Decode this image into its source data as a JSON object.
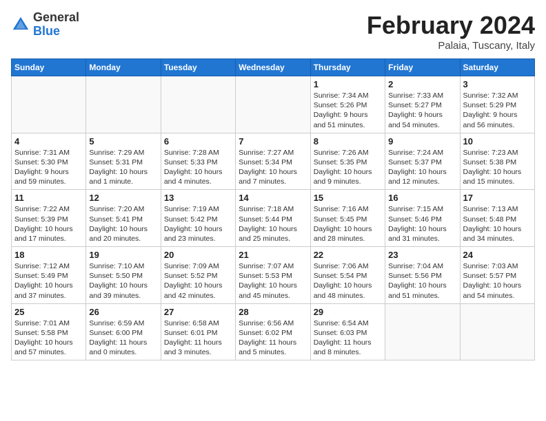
{
  "header": {
    "logo_general": "General",
    "logo_blue": "Blue",
    "month_title": "February 2024",
    "location": "Palaia, Tuscany, Italy"
  },
  "days_of_week": [
    "Sunday",
    "Monday",
    "Tuesday",
    "Wednesday",
    "Thursday",
    "Friday",
    "Saturday"
  ],
  "weeks": [
    [
      {
        "day": "",
        "info": ""
      },
      {
        "day": "",
        "info": ""
      },
      {
        "day": "",
        "info": ""
      },
      {
        "day": "",
        "info": ""
      },
      {
        "day": "1",
        "info": "Sunrise: 7:34 AM\nSunset: 5:26 PM\nDaylight: 9 hours\nand 51 minutes."
      },
      {
        "day": "2",
        "info": "Sunrise: 7:33 AM\nSunset: 5:27 PM\nDaylight: 9 hours\nand 54 minutes."
      },
      {
        "day": "3",
        "info": "Sunrise: 7:32 AM\nSunset: 5:29 PM\nDaylight: 9 hours\nand 56 minutes."
      }
    ],
    [
      {
        "day": "4",
        "info": "Sunrise: 7:31 AM\nSunset: 5:30 PM\nDaylight: 9 hours\nand 59 minutes."
      },
      {
        "day": "5",
        "info": "Sunrise: 7:29 AM\nSunset: 5:31 PM\nDaylight: 10 hours\nand 1 minute."
      },
      {
        "day": "6",
        "info": "Sunrise: 7:28 AM\nSunset: 5:33 PM\nDaylight: 10 hours\nand 4 minutes."
      },
      {
        "day": "7",
        "info": "Sunrise: 7:27 AM\nSunset: 5:34 PM\nDaylight: 10 hours\nand 7 minutes."
      },
      {
        "day": "8",
        "info": "Sunrise: 7:26 AM\nSunset: 5:35 PM\nDaylight: 10 hours\nand 9 minutes."
      },
      {
        "day": "9",
        "info": "Sunrise: 7:24 AM\nSunset: 5:37 PM\nDaylight: 10 hours\nand 12 minutes."
      },
      {
        "day": "10",
        "info": "Sunrise: 7:23 AM\nSunset: 5:38 PM\nDaylight: 10 hours\nand 15 minutes."
      }
    ],
    [
      {
        "day": "11",
        "info": "Sunrise: 7:22 AM\nSunset: 5:39 PM\nDaylight: 10 hours\nand 17 minutes."
      },
      {
        "day": "12",
        "info": "Sunrise: 7:20 AM\nSunset: 5:41 PM\nDaylight: 10 hours\nand 20 minutes."
      },
      {
        "day": "13",
        "info": "Sunrise: 7:19 AM\nSunset: 5:42 PM\nDaylight: 10 hours\nand 23 minutes."
      },
      {
        "day": "14",
        "info": "Sunrise: 7:18 AM\nSunset: 5:44 PM\nDaylight: 10 hours\nand 25 minutes."
      },
      {
        "day": "15",
        "info": "Sunrise: 7:16 AM\nSunset: 5:45 PM\nDaylight: 10 hours\nand 28 minutes."
      },
      {
        "day": "16",
        "info": "Sunrise: 7:15 AM\nSunset: 5:46 PM\nDaylight: 10 hours\nand 31 minutes."
      },
      {
        "day": "17",
        "info": "Sunrise: 7:13 AM\nSunset: 5:48 PM\nDaylight: 10 hours\nand 34 minutes."
      }
    ],
    [
      {
        "day": "18",
        "info": "Sunrise: 7:12 AM\nSunset: 5:49 PM\nDaylight: 10 hours\nand 37 minutes."
      },
      {
        "day": "19",
        "info": "Sunrise: 7:10 AM\nSunset: 5:50 PM\nDaylight: 10 hours\nand 39 minutes."
      },
      {
        "day": "20",
        "info": "Sunrise: 7:09 AM\nSunset: 5:52 PM\nDaylight: 10 hours\nand 42 minutes."
      },
      {
        "day": "21",
        "info": "Sunrise: 7:07 AM\nSunset: 5:53 PM\nDaylight: 10 hours\nand 45 minutes."
      },
      {
        "day": "22",
        "info": "Sunrise: 7:06 AM\nSunset: 5:54 PM\nDaylight: 10 hours\nand 48 minutes."
      },
      {
        "day": "23",
        "info": "Sunrise: 7:04 AM\nSunset: 5:56 PM\nDaylight: 10 hours\nand 51 minutes."
      },
      {
        "day": "24",
        "info": "Sunrise: 7:03 AM\nSunset: 5:57 PM\nDaylight: 10 hours\nand 54 minutes."
      }
    ],
    [
      {
        "day": "25",
        "info": "Sunrise: 7:01 AM\nSunset: 5:58 PM\nDaylight: 10 hours\nand 57 minutes."
      },
      {
        "day": "26",
        "info": "Sunrise: 6:59 AM\nSunset: 6:00 PM\nDaylight: 11 hours\nand 0 minutes."
      },
      {
        "day": "27",
        "info": "Sunrise: 6:58 AM\nSunset: 6:01 PM\nDaylight: 11 hours\nand 3 minutes."
      },
      {
        "day": "28",
        "info": "Sunrise: 6:56 AM\nSunset: 6:02 PM\nDaylight: 11 hours\nand 5 minutes."
      },
      {
        "day": "29",
        "info": "Sunrise: 6:54 AM\nSunset: 6:03 PM\nDaylight: 11 hours\nand 8 minutes."
      },
      {
        "day": "",
        "info": ""
      },
      {
        "day": "",
        "info": ""
      }
    ]
  ]
}
